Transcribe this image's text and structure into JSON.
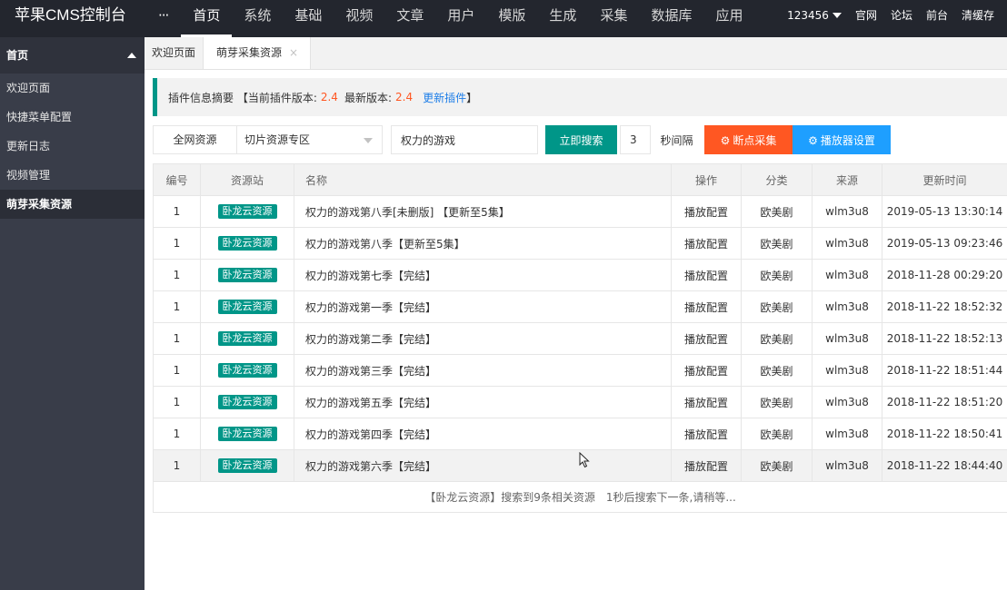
{
  "app": {
    "title": "苹果CMS控制台"
  },
  "topnav": {
    "more": "···",
    "items": [
      "首页",
      "系统",
      "基础",
      "视频",
      "文章",
      "用户",
      "模版",
      "生成",
      "采集",
      "数据库",
      "应用"
    ]
  },
  "topright": {
    "user": "123456",
    "links": [
      "官网",
      "论坛",
      "前台",
      "清缓存"
    ]
  },
  "sidebar": {
    "header": "首页",
    "items": [
      "欢迎页面",
      "快捷菜单配置",
      "更新日志",
      "视频管理",
      "萌芽采集资源"
    ]
  },
  "tabs": [
    {
      "label": "欢迎页面"
    },
    {
      "label": "萌芽采集资源",
      "close": "×"
    }
  ],
  "notice": {
    "prefix": "插件信息摘要 【当前插件版本:",
    "current": "2.4",
    "latest_label": "最新版本:",
    "latest": "2.4",
    "update": "更新插件",
    "suffix": "】"
  },
  "toolbar": {
    "all_sources": "全网资源",
    "category": "切片资源专区",
    "keyword": "权力的游戏",
    "search": "立即搜索",
    "interval": "3",
    "interval_label": "秒间隔",
    "resume": "断点采集",
    "player": "播放器设置"
  },
  "table": {
    "headers": [
      "编号",
      "资源站",
      "名称",
      "操作",
      "分类",
      "来源",
      "更新时间"
    ],
    "rows": [
      {
        "id": "1",
        "site": "卧龙云资源",
        "name": "权力的游戏第八季[未删版] 【更新至5集】",
        "op": "播放配置",
        "cat": "欧美剧",
        "src": "wlm3u8",
        "time": "2019-05-13 13:30:14"
      },
      {
        "id": "1",
        "site": "卧龙云资源",
        "name": "权力的游戏第八季【更新至5集】",
        "op": "播放配置",
        "cat": "欧美剧",
        "src": "wlm3u8",
        "time": "2019-05-13 09:23:46"
      },
      {
        "id": "1",
        "site": "卧龙云资源",
        "name": "权力的游戏第七季【完结】",
        "op": "播放配置",
        "cat": "欧美剧",
        "src": "wlm3u8",
        "time": "2018-11-28 00:29:20"
      },
      {
        "id": "1",
        "site": "卧龙云资源",
        "name": "权力的游戏第一季【完结】",
        "op": "播放配置",
        "cat": "欧美剧",
        "src": "wlm3u8",
        "time": "2018-11-22 18:52:32"
      },
      {
        "id": "1",
        "site": "卧龙云资源",
        "name": "权力的游戏第二季【完结】",
        "op": "播放配置",
        "cat": "欧美剧",
        "src": "wlm3u8",
        "time": "2018-11-22 18:52:13"
      },
      {
        "id": "1",
        "site": "卧龙云资源",
        "name": "权力的游戏第三季【完结】",
        "op": "播放配置",
        "cat": "欧美剧",
        "src": "wlm3u8",
        "time": "2018-11-22 18:51:44"
      },
      {
        "id": "1",
        "site": "卧龙云资源",
        "name": "权力的游戏第五季【完结】",
        "op": "播放配置",
        "cat": "欧美剧",
        "src": "wlm3u8",
        "time": "2018-11-22 18:51:20"
      },
      {
        "id": "1",
        "site": "卧龙云资源",
        "name": "权力的游戏第四季【完结】",
        "op": "播放配置",
        "cat": "欧美剧",
        "src": "wlm3u8",
        "time": "2018-11-22 18:50:41"
      },
      {
        "id": "1",
        "site": "卧龙云资源",
        "name": "权力的游戏第六季【完结】",
        "op": "播放配置",
        "cat": "欧美剧",
        "src": "wlm3u8",
        "time": "2018-11-22 18:44:40"
      }
    ],
    "footer": "【卧龙云资源】搜索到9条相关资源　1秒后搜索下一条,请稍等..."
  },
  "colors": {
    "topbar": "#23262e",
    "sidebar": "#393d49",
    "primary": "#009688",
    "orange": "#ff5722",
    "blue": "#1e9fff"
  },
  "icons": {
    "resume": "gear-icon",
    "player": "gear-icon",
    "cursor": "mouse-pointer-icon"
  }
}
